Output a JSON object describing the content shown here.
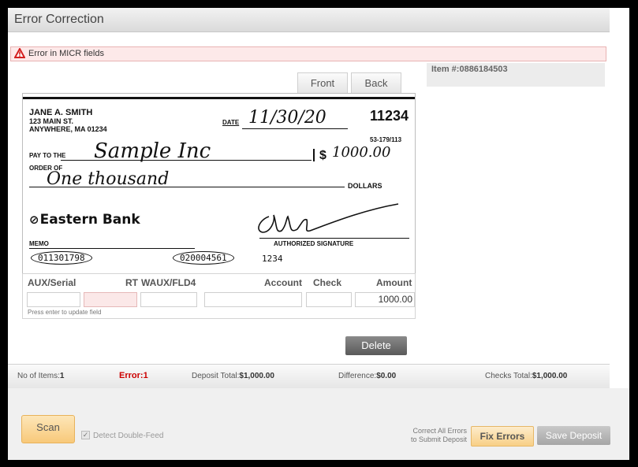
{
  "window": {
    "title": "Error Correction"
  },
  "error_banner": {
    "message": "Error in MICR fields",
    "icon": "warning-icon"
  },
  "item_panel": {
    "item_label": "Item #:0886184503"
  },
  "tabs": [
    {
      "label": "Front"
    },
    {
      "label": "Back"
    }
  ],
  "check_image": {
    "name": "JANE A. SMITH",
    "address1": "123 MAIN ST.",
    "address2": "ANYWHERE, MA 01234",
    "date_label": "DATE",
    "date_value": "11/30/20",
    "check_number": "11234",
    "routing_fraction": "53-179/113",
    "pay_to_label1": "PAY TO THE",
    "pay_to_label2": "ORDER OF",
    "payee": "Sample Inc",
    "amount_symbol": "$",
    "amount": "1000.00",
    "written_amount": "One thousand",
    "dollars_label": "DOLLARS",
    "bank": "Eastern Bank",
    "memo_label": "MEMO",
    "auth_sig_label": "AUTHORIZED SIGNATURE",
    "micr_routing": "011301798",
    "micr_account": "020004561",
    "micr_check": "1234"
  },
  "fields": {
    "headers": {
      "aux_serial": "AUX/Serial",
      "rt": "RT",
      "waux": "WAUX/FLD4",
      "account": "Account",
      "check": "Check",
      "amount": "Amount"
    },
    "values": {
      "aux_serial": "",
      "rt": "",
      "waux": "",
      "account": "",
      "check": "",
      "amount": "1000.00"
    },
    "hint": "Press enter to update field"
  },
  "delete_button": {
    "label": "Delete"
  },
  "status": {
    "items_label": "No of Items:",
    "items_value": "1",
    "error_label": "Error:",
    "error_value": "1",
    "deposit_total_label": "Deposit Total:",
    "deposit_total_value": "$1,000.00",
    "difference_label": "Difference:",
    "difference_value": "$0.00",
    "checks_total_label": "Checks Total:",
    "checks_total_value": "$1,000.00"
  },
  "footer": {
    "scan_label": "Scan",
    "detect_double_feed": "Detect Double-Feed",
    "detect_checked": true,
    "correct_all_line1": "Correct All Errors",
    "correct_all_line2": "to Submit Deposit",
    "fix_errors_label": "Fix Errors",
    "save_deposit_label": "Save Deposit"
  },
  "colors": {
    "error_text": "#cc0000",
    "highlight": "#fdf27a",
    "error_bg": "#fde9e9",
    "rt_invalid_bg": "#fbe8e8"
  }
}
